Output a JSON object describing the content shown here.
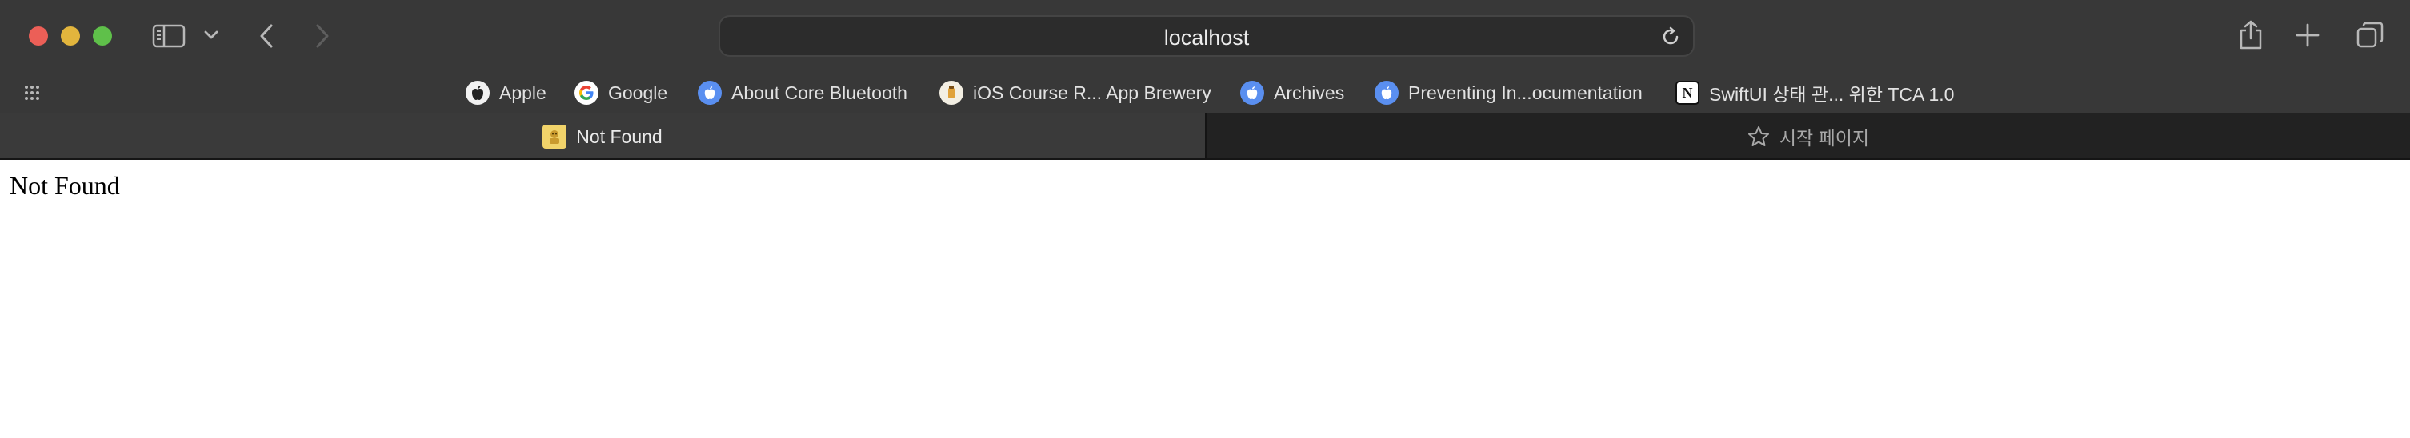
{
  "window": {
    "traffic_lights": {
      "close": "#ec5f57",
      "minimize": "#e2b53d",
      "zoom": "#5fc04a"
    }
  },
  "toolbar": {
    "sidebar_icon": "sidebar-icon",
    "tabs_dropdown_icon": "chevron-down-icon",
    "back_icon": "chevron-left-icon",
    "forward_icon": "chevron-right-icon",
    "share_icon": "share-icon",
    "new_tab_icon": "plus-icon",
    "tab_overview_icon": "tab-overview-icon"
  },
  "address_bar": {
    "value": "localhost",
    "reload_icon": "reload-icon"
  },
  "favorites": [
    {
      "label": "Apple",
      "icon": "apple-icon"
    },
    {
      "label": "Google",
      "icon": "google-icon"
    },
    {
      "label": "About Core Bluetooth",
      "icon": "apple-developer-icon"
    },
    {
      "label": "iOS Course R... App Brewery",
      "icon": "app-brewery-icon"
    },
    {
      "label": "Archives",
      "icon": "apple-developer-icon"
    },
    {
      "label": "Preventing In...ocumentation",
      "icon": "apple-developer-icon"
    },
    {
      "label": "SwiftUI 상태 관... 위한 TCA 1.0",
      "icon": "notion-icon"
    }
  ],
  "tabs": [
    {
      "label": "Not Found",
      "active": true,
      "icon": "page-favicon-icon"
    },
    {
      "label": "시작 페이지",
      "active": false,
      "icon": "star-icon"
    }
  ],
  "page": {
    "body_text": "Not Found"
  },
  "colors": {
    "chrome_bg": "#383838",
    "inactive_tab_bg": "#222222",
    "page_bg": "#ffffff"
  }
}
